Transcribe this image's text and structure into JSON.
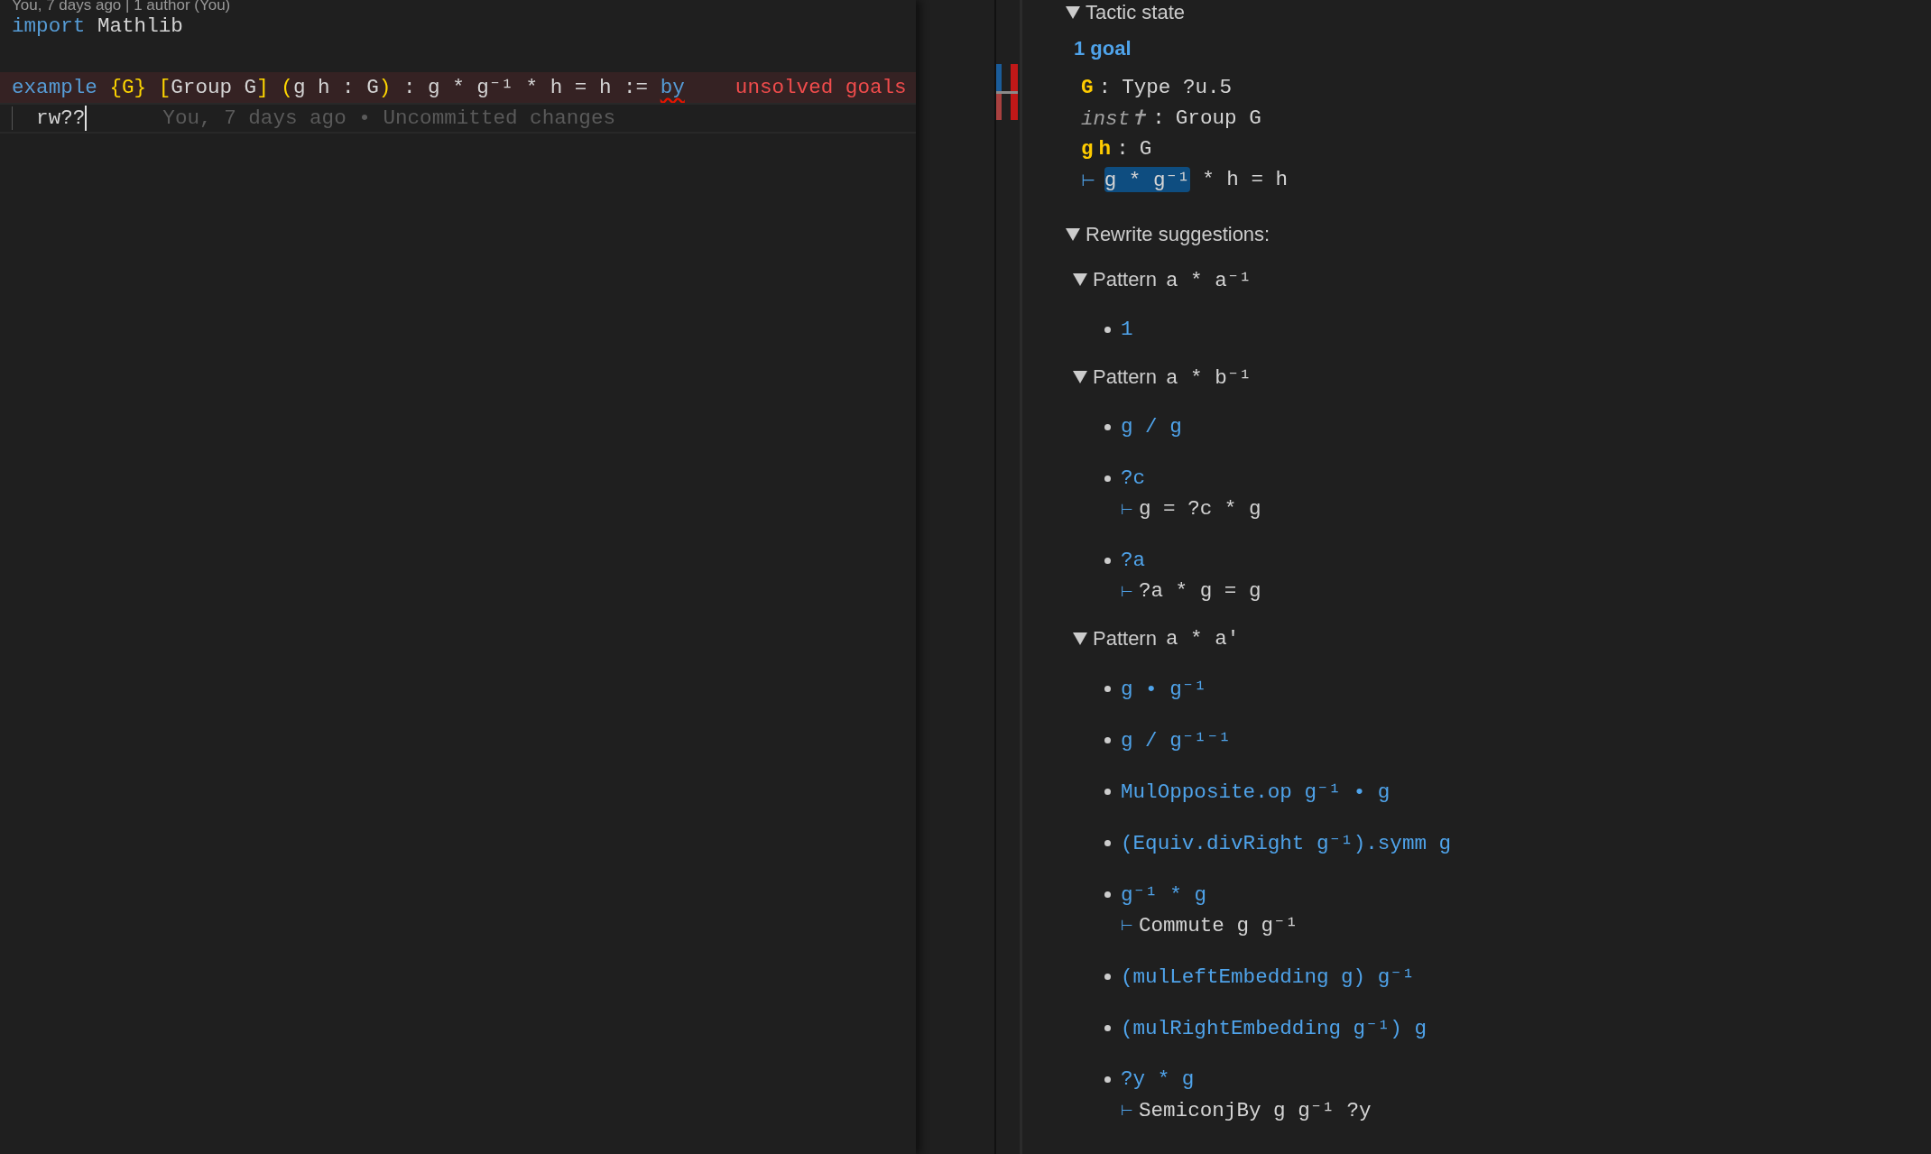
{
  "editor": {
    "codelens": "You, 7 days ago | 1 author (You)",
    "lines": [
      {
        "error": false,
        "current": false,
        "tokens": [
          {
            "text": "import",
            "kind": "keyword"
          },
          {
            "text": " Mathlib",
            "kind": "plain"
          }
        ]
      },
      {
        "error": false,
        "current": false
      },
      {
        "error": true,
        "current": false,
        "tokens": [
          {
            "text": "example ",
            "kind": "keyword"
          },
          {
            "text": "{G} [",
            "kind": "bracket"
          },
          {
            "text": "Group G",
            "kind": "plain"
          },
          {
            "text": "] (",
            "kind": "bracket"
          },
          {
            "text": "g h : G",
            "kind": "plain"
          },
          {
            "text": ")",
            "kind": "bracket"
          },
          {
            "text": " : g * g⁻¹ * h = h := ",
            "kind": "plain"
          },
          {
            "text": "by",
            "kind": "squiggle"
          }
        ],
        "error_message": "unsolved goals"
      },
      {
        "error": false,
        "current": true,
        "cursor": true,
        "tokens": [
          {
            "text": "  rw??",
            "kind": "plain"
          }
        ],
        "blame": "You, 7 days ago • Uncommitted changes"
      }
    ]
  },
  "infoview": {
    "tactic_state": {
      "title": "Tactic state",
      "expanded": true,
      "goal_count": "1 goal",
      "hypotheses": [
        {
          "names": [
            {
              "text": "G",
              "inaccessible": false
            }
          ],
          "separator": ":",
          "type": "Type ?u.5"
        },
        {
          "names": [
            {
              "text": "inst✝",
              "inaccessible": true
            }
          ],
          "separator": ":",
          "type": "Group G"
        },
        {
          "names": [
            {
              "text": "g",
              "inaccessible": false
            },
            {
              "text": "h",
              "inaccessible": false
            }
          ],
          "separator": ":",
          "type": "G"
        }
      ],
      "goal": {
        "turnstile": "⊢",
        "parts": [
          {
            "text": "g * g⁻¹",
            "selected": true
          },
          {
            "text": " * h = h",
            "selected": false
          }
        ]
      }
    },
    "rewrite": {
      "title": "Rewrite suggestions:",
      "expanded": true,
      "patterns": [
        {
          "label": "Pattern",
          "pattern": "a * a⁻¹",
          "expanded": true,
          "items": [
            {
              "expr": "1"
            }
          ]
        },
        {
          "label": "Pattern",
          "pattern": "a * b⁻¹",
          "expanded": true,
          "items": [
            {
              "expr": "g / g"
            },
            {
              "expr": "?c",
              "turnstile": "⊢",
              "goal": "g = ?c * g"
            },
            {
              "expr": "?a",
              "turnstile": "⊢",
              "goal": "?a * g = g"
            }
          ]
        },
        {
          "label": "Pattern",
          "pattern": "a * a'",
          "expanded": true,
          "items": [
            {
              "expr": "g • g⁻¹"
            },
            {
              "expr": "g / g⁻¹⁻¹"
            },
            {
              "expr": "MulOpposite.op g⁻¹ • g"
            },
            {
              "expr": "(Equiv.divRight g⁻¹).symm g"
            },
            {
              "expr": "g⁻¹ * g",
              "turnstile": "⊢",
              "goal": "Commute g g⁻¹"
            },
            {
              "expr": "(mulLeftEmbedding g) g⁻¹"
            },
            {
              "expr": "(mulRightEmbedding g⁻¹) g"
            },
            {
              "expr": "?y * g",
              "turnstile": "⊢",
              "goal": "SemiconjBy g g⁻¹ ?y"
            }
          ]
        }
      ]
    }
  }
}
